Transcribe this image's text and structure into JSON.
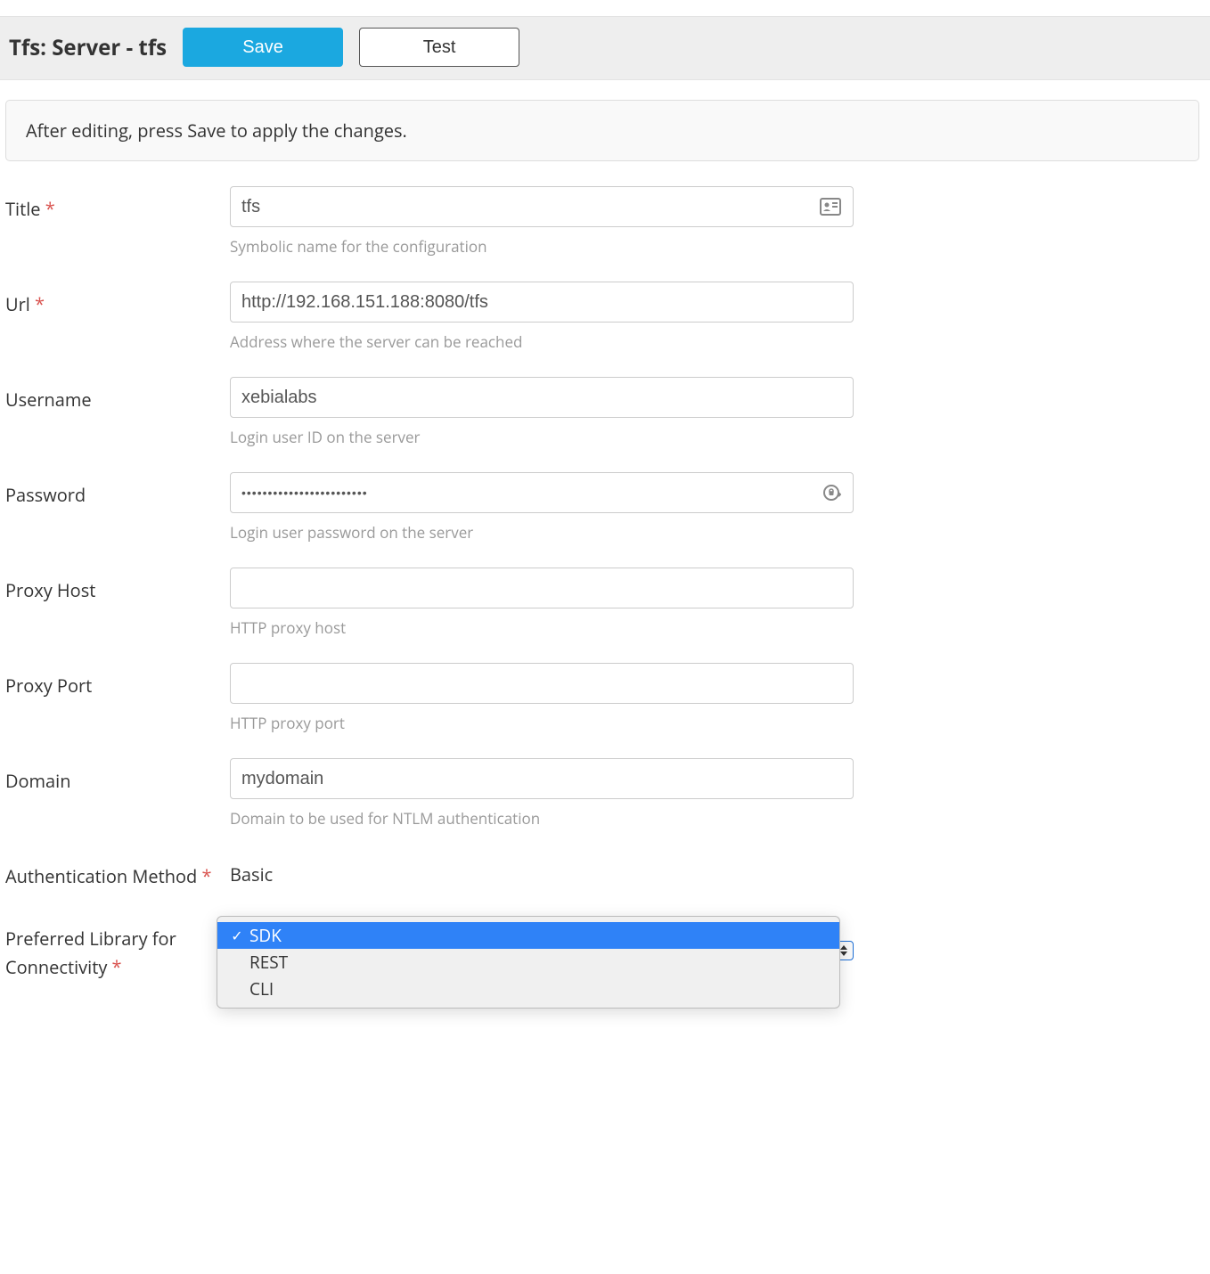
{
  "header": {
    "title": "Tfs: Server - tfs",
    "save_label": "Save",
    "test_label": "Test"
  },
  "info": {
    "message": "After editing, press Save to apply the changes."
  },
  "form": {
    "title": {
      "label": "Title",
      "required": true,
      "value": "tfs",
      "help": "Symbolic name for the configuration"
    },
    "url": {
      "label": "Url",
      "required": true,
      "value": "http://192.168.151.188:8080/tfs",
      "help": "Address where the server can be reached"
    },
    "username": {
      "label": "Username",
      "required": false,
      "value": "xebialabs",
      "help": "Login user ID on the server"
    },
    "password": {
      "label": "Password",
      "required": false,
      "value": "••••••••••••••••••••••••",
      "help": "Login user password on the server"
    },
    "proxy_host": {
      "label": "Proxy Host",
      "required": false,
      "value": "",
      "help": "HTTP proxy host"
    },
    "proxy_port": {
      "label": "Proxy Port",
      "required": false,
      "value": "",
      "help": "HTTP proxy port"
    },
    "domain": {
      "label": "Domain",
      "required": false,
      "value": "mydomain",
      "help": "Domain to be used for NTLM authentication"
    },
    "auth_method": {
      "label": "Authentication Method",
      "required": true,
      "value": "Basic"
    },
    "preferred_library": {
      "label": "Preferred Library for Connectivity",
      "required": true,
      "selected": "SDK",
      "options": [
        "SDK",
        "REST",
        "CLI"
      ]
    }
  },
  "required_marker": "*"
}
